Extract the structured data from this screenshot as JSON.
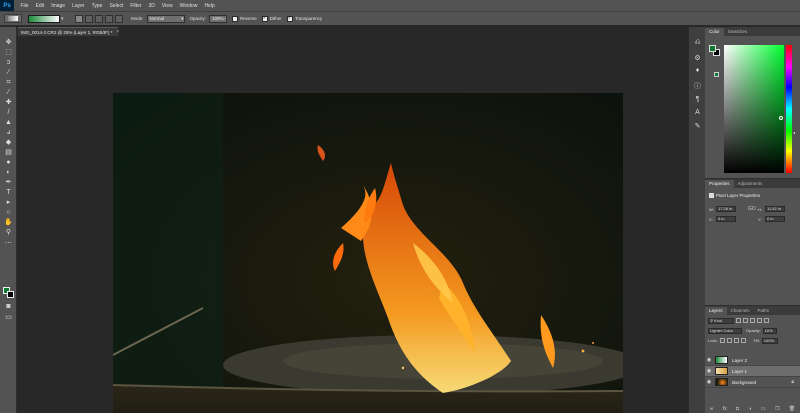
{
  "menubar": {
    "logo": "Ps",
    "items": [
      "File",
      "Edit",
      "Image",
      "Layer",
      "Type",
      "Select",
      "Filter",
      "3D",
      "View",
      "Window",
      "Help"
    ]
  },
  "options": {
    "mode_label": "Mode:",
    "mode_value": "Normal",
    "opacity_label": "Opacity:",
    "opacity_value": "100%",
    "reverse_label": "Reverse",
    "reverse_checked": false,
    "dither_label": "Dither",
    "dither_checked": true,
    "transparency_label": "Transparency",
    "transparency_checked": true,
    "gradient_colors": [
      "#1d8a3b",
      "#ffffff"
    ]
  },
  "document": {
    "tab_title": "IMG_0014-2.CR2 @ 25% (Layer 1, RGB/8*) *",
    "close": "×"
  },
  "colors": {
    "foreground": "#0a7a30",
    "background": "#000000"
  },
  "color_panel": {
    "tabs": [
      "Color",
      "Swatches"
    ]
  },
  "properties_panel": {
    "tabs": [
      "Properties",
      "Adjustments"
    ],
    "title": "Pixel Layer Properties",
    "w_label": "W:",
    "w_value": "17.28 in",
    "h_label": "H:",
    "h_value": "11.52 in",
    "x_label": "X:",
    "x_value": "0 in",
    "y_label": "Y:",
    "y_value": "0 in",
    "link_label": "GO"
  },
  "layers_panel": {
    "tabs": [
      "Layers",
      "Channels",
      "Paths"
    ],
    "filter_value": "Kind",
    "blend_mode": "Lighter Color",
    "opacity_label": "Opacity:",
    "opacity_value": "16%",
    "lock_label": "Lock:",
    "fill_label": "Fill:",
    "fill_value": "100%",
    "layers": [
      {
        "name": "Layer 2",
        "selected": false,
        "locked": false
      },
      {
        "name": "Layer 1",
        "selected": true,
        "locked": false
      },
      {
        "name": "Background",
        "selected": false,
        "locked": true
      }
    ]
  }
}
